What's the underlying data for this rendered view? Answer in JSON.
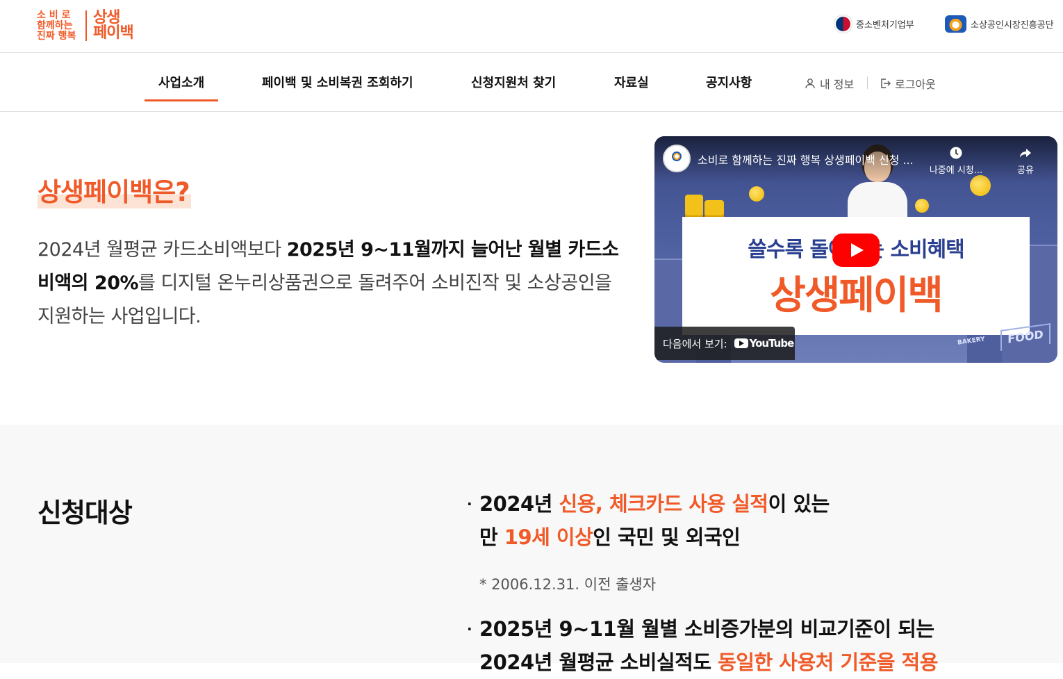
{
  "header": {
    "logo": {
      "sub_lines": [
        "소 비 로",
        "함께하는",
        "진짜 행복"
      ],
      "main_lines": [
        "상생",
        "페이백"
      ]
    },
    "gov_links": [
      {
        "label": "중소벤처기업부",
        "icon": "taegeuk-emblem-icon"
      },
      {
        "label": "소상공인시장진흥공단",
        "icon": "semas-logo-icon"
      }
    ]
  },
  "nav": {
    "items": [
      {
        "label": "사업소개",
        "active": true
      },
      {
        "label": "페이백 및 소비복권 조회하기"
      },
      {
        "label": "신청지원처 찾기"
      },
      {
        "label": "자료실"
      },
      {
        "label": "공지사항"
      }
    ],
    "my_info": "내 정보",
    "logout": "로그아웃"
  },
  "intro": {
    "title": "상생페이백은?",
    "desc_part1": "2024년 월평균 카드소비액보다 ",
    "desc_bold": "2025년 9~11월까지 늘어난 월별 카드소비액의 20%",
    "desc_part2": "를 디지털 온누리상품권으로 돌려주어 소비진작 및 소상공인을 지원하는 사업입니다."
  },
  "video": {
    "title": "소비로 함께하는 진짜 행복 상생페이백 신청 ...",
    "watch_later": "나중에 시청...",
    "share": "공유",
    "banner_line1": "쓸수록 돌아오는 소비혜택",
    "banner_line2": "상생페이백",
    "watch_on": "다음에서 보기:",
    "youtube": "YouTube",
    "sign_food": "FOOD",
    "sign_bakery": "BAKERY"
  },
  "target": {
    "title": "신청대상",
    "b1_pre": "2024년 ",
    "b1_hl": "신용, 체크카드 사용 실적",
    "b1_post": "이 있는",
    "b2_pre": "만 ",
    "b2_hl": "19세 이상",
    "b2_post": "인 국민 및 외국인",
    "note": "* 2006.12.31. 이전 출생자",
    "b3": "2025년 9~11월 월별 소비증가분의 비교기준이 되는",
    "b4_pre": "2024년 월평균 소비실적도 ",
    "b4_hl": "동일한 사용처 기준을 적용"
  },
  "colors": {
    "accent": "#f05a28",
    "nav_underline": "#f05a28",
    "section_bg": "#f8f8f8"
  }
}
